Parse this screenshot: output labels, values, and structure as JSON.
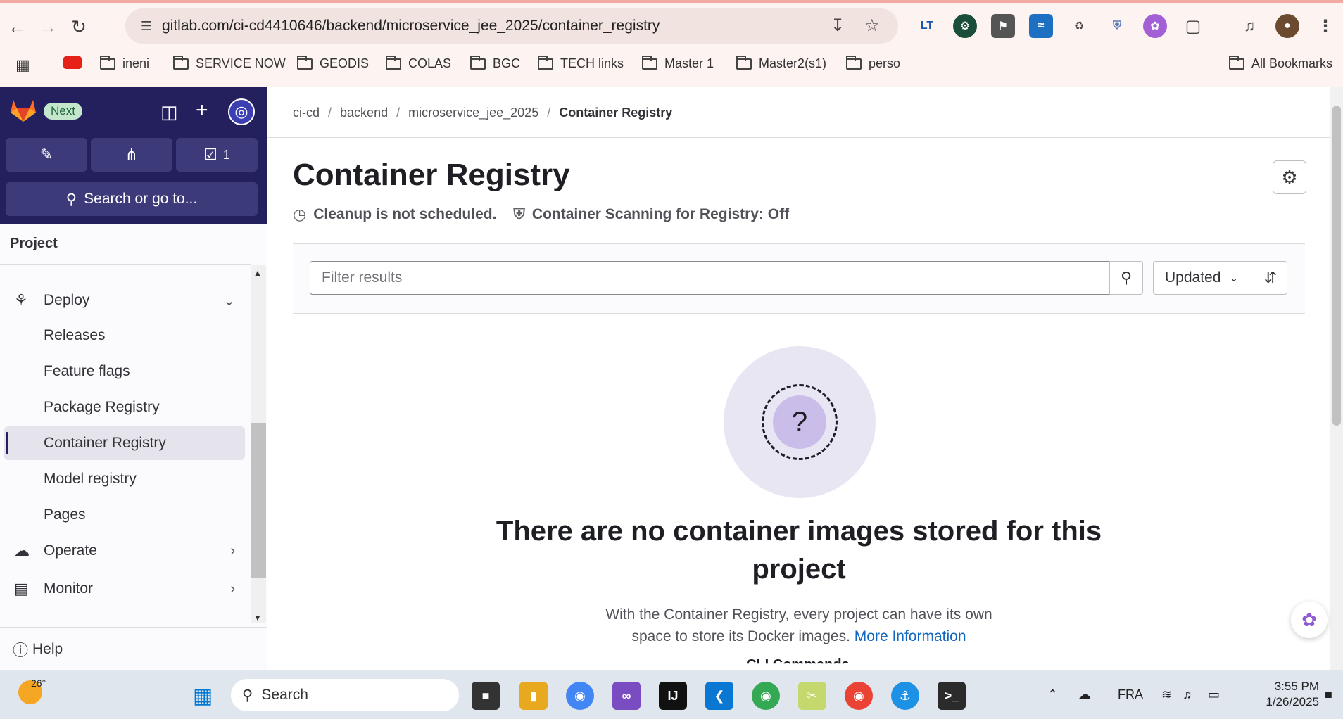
{
  "browser": {
    "url": "gitlab.com/ci-cd4410646/backend/microservice_jee_2025/container_registry",
    "bookmarks": [
      "ineni",
      "SERVICE NOW",
      "GEODIS",
      "COLAS",
      "BGC",
      "TECH links",
      "Master 1",
      "Master2(s1)",
      "perso"
    ],
    "all_bookmarks": "All Bookmarks",
    "ext_lt": "LT"
  },
  "sidebar": {
    "next_badge": "Next",
    "todo_count": "1",
    "search_label": "Search or go to...",
    "section_title": "Project",
    "items": [
      {
        "label": "Deploy",
        "icon": "rocket-icon",
        "expanded": true
      },
      {
        "label": "Releases"
      },
      {
        "label": "Feature flags"
      },
      {
        "label": "Package Registry"
      },
      {
        "label": "Container Registry",
        "active": true
      },
      {
        "label": "Model registry"
      },
      {
        "label": "Pages"
      },
      {
        "label": "Operate",
        "icon": "cloud-icon"
      },
      {
        "label": "Monitor",
        "icon": "monitor-icon"
      }
    ],
    "help_label": "Help"
  },
  "breadcrumb": [
    "ci-cd",
    "backend",
    "microservice_jee_2025",
    "Container Registry"
  ],
  "page": {
    "title": "Container Registry",
    "cleanup_status": "Cleanup is not scheduled.",
    "scanning_status": "Container Scanning for Registry: Off",
    "filter_placeholder": "Filter results",
    "sort_value": "Updated"
  },
  "empty_state": {
    "title": "There are no container images stored for this project",
    "description": "With the Container Registry, every project can have its own space to store its Docker images.",
    "link": "More Information",
    "cut_heading": "CLI Commands"
  },
  "taskbar": {
    "temperature": "26°",
    "search_label": "Search",
    "language": "FRA",
    "time": "3:55 PM",
    "date": "1/26/2025"
  },
  "colors": {
    "sidebar_dark": "#24205e",
    "link": "#1068bf",
    "illustration_bg": "#e9e6f3"
  }
}
